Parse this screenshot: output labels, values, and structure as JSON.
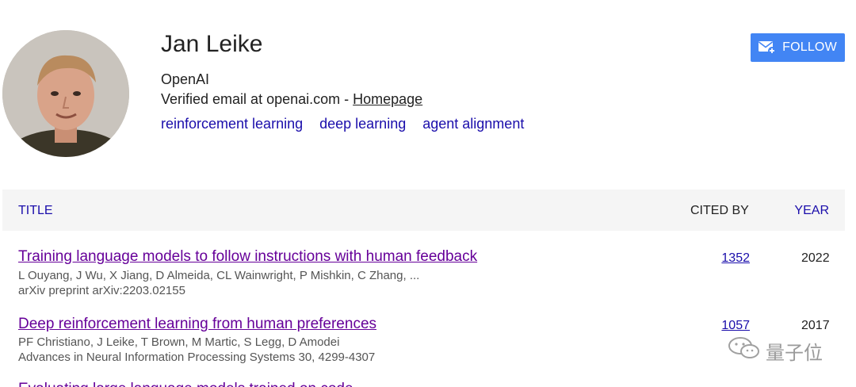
{
  "profile": {
    "name": "Jan Leike",
    "affiliation": "OpenAI",
    "email_text": "Verified email at openai.com - ",
    "homepage_label": "Homepage",
    "interests": [
      "reinforcement learning",
      "deep learning",
      "agent alignment"
    ],
    "follow_label": "FOLLOW"
  },
  "table": {
    "headers": {
      "title": "TITLE",
      "cited_by": "CITED BY",
      "year": "YEAR"
    },
    "rows": [
      {
        "title": "Training language models to follow instructions with human feedback",
        "authors": "L Ouyang, J Wu, X Jiang, D Almeida, CL Wainwright, P Mishkin, C Zhang, ...",
        "venue": "arXiv preprint arXiv:2203.02155",
        "cited_by": "1352",
        "year": "2022"
      },
      {
        "title": "Deep reinforcement learning from human preferences",
        "authors": "PF Christiano, J Leike, T Brown, M Martic, S Legg, D Amodei",
        "venue": "Advances in Neural Information Processing Systems 30, 4299-4307",
        "cited_by": "1057",
        "year": "2017"
      },
      {
        "title": "Evaluating large language models trained on code",
        "authors": "",
        "venue": "",
        "cited_by": "",
        "year": ""
      }
    ]
  },
  "watermark": {
    "text": "量子位",
    "icon": "wechat-icon"
  },
  "colors": {
    "link": "#1a0dab",
    "visited": "#660099",
    "follow_bg": "#4285f4",
    "header_bg": "#f5f5f5"
  }
}
